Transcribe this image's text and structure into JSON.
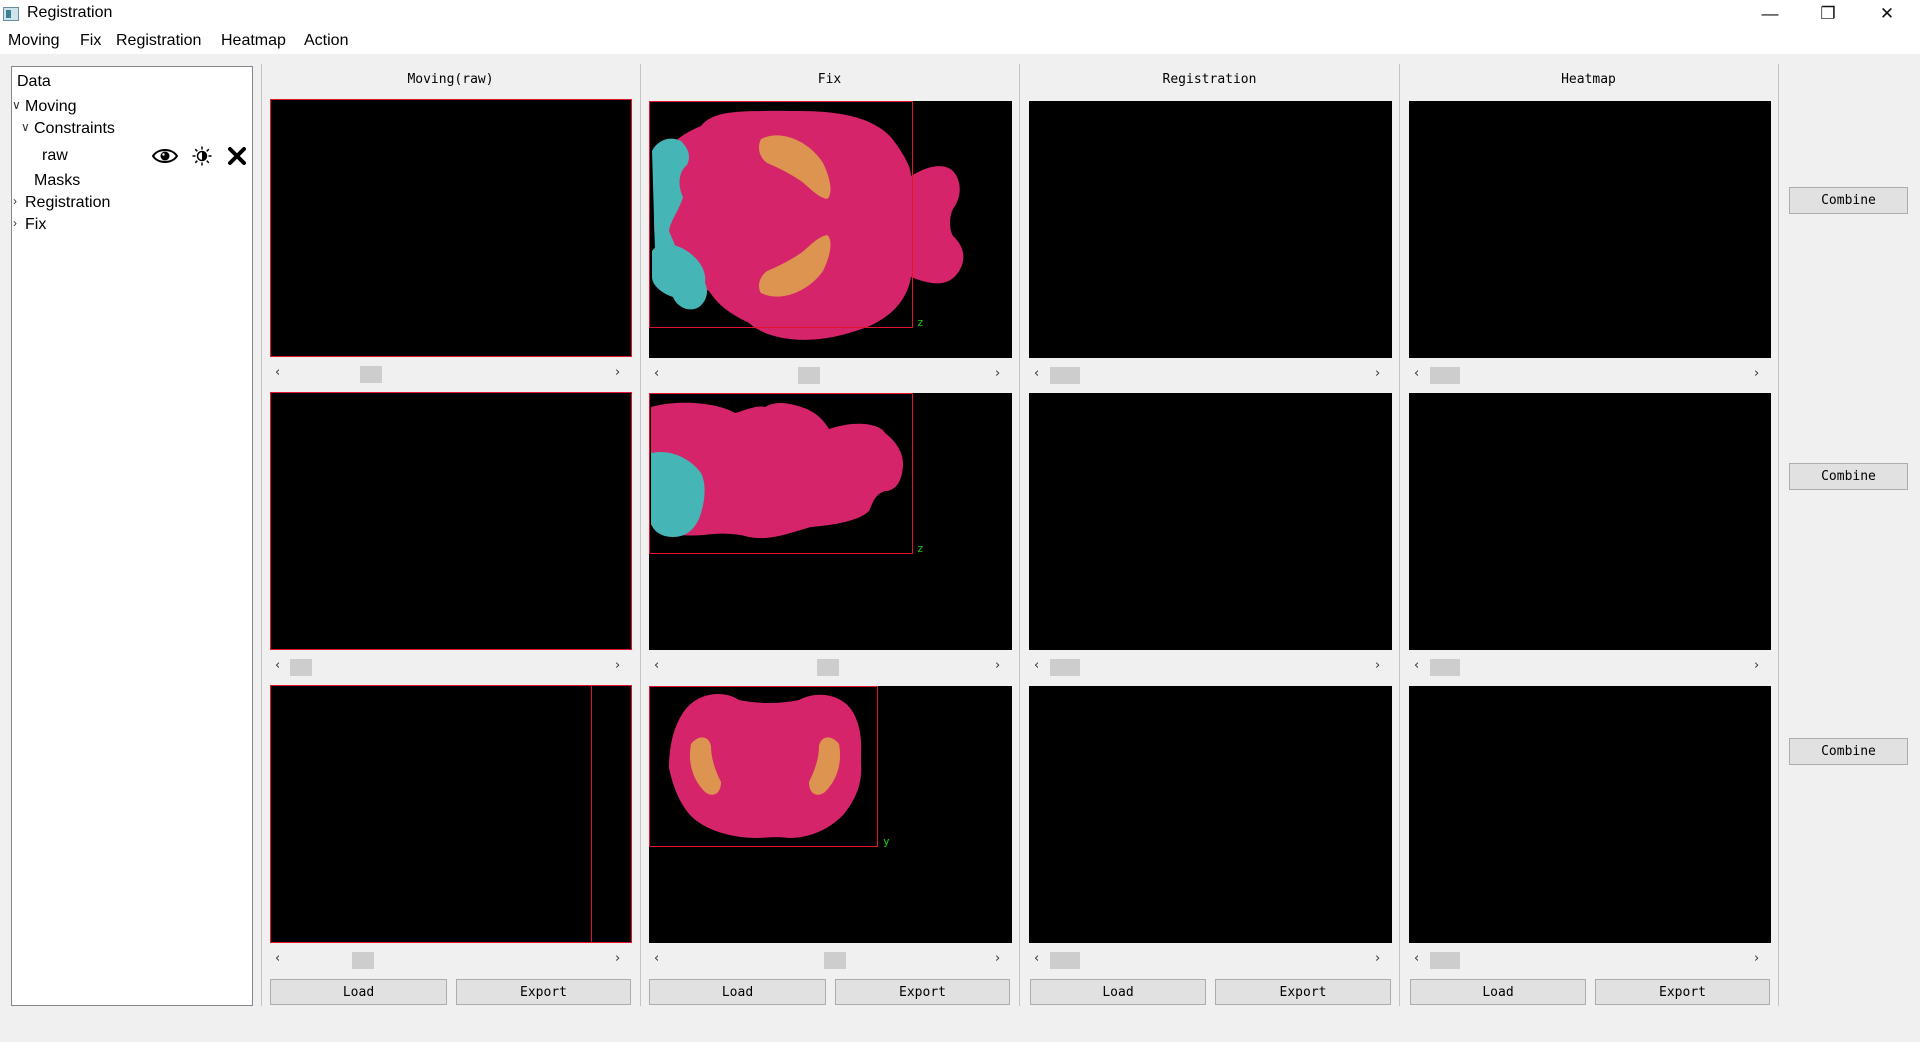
{
  "window": {
    "title": "Registration",
    "controls": {
      "minimize": "—",
      "maximize": "❐",
      "close": "✕"
    }
  },
  "menu": [
    "Moving",
    "Fix",
    "Registration",
    "Heatmap",
    "Action"
  ],
  "tree": {
    "header": "Data",
    "moving": "Moving",
    "constraints": "Constraints",
    "raw": "raw",
    "masks": "Masks",
    "registration": "Registration",
    "fix": "Fix",
    "raw_icons": [
      "eye-icon",
      "brightness-icon",
      "close-icon"
    ]
  },
  "columns": [
    {
      "title": "Moving(raw)",
      "load": "Load",
      "export": "Export"
    },
    {
      "title": "Fix",
      "load": "Load",
      "export": "Export"
    },
    {
      "title": "Registration",
      "load": "Load",
      "export": "Export"
    },
    {
      "title": "Heatmap",
      "load": "Load",
      "export": "Export"
    }
  ],
  "combine": [
    "Combine",
    "Combine",
    "Combine"
  ],
  "axis_labels": {
    "fix_row1": "z",
    "fix_row2": "z",
    "fix_row3": "y"
  },
  "scroll_arrows": {
    "left": "‹",
    "right": "›"
  },
  "colors": {
    "brain_region": "#d6246a",
    "olfactory_region": "#45b5b5",
    "hippocampus_region": "#dc9450",
    "bounding_box": "#e0142a",
    "axis_label": "#19d119"
  }
}
